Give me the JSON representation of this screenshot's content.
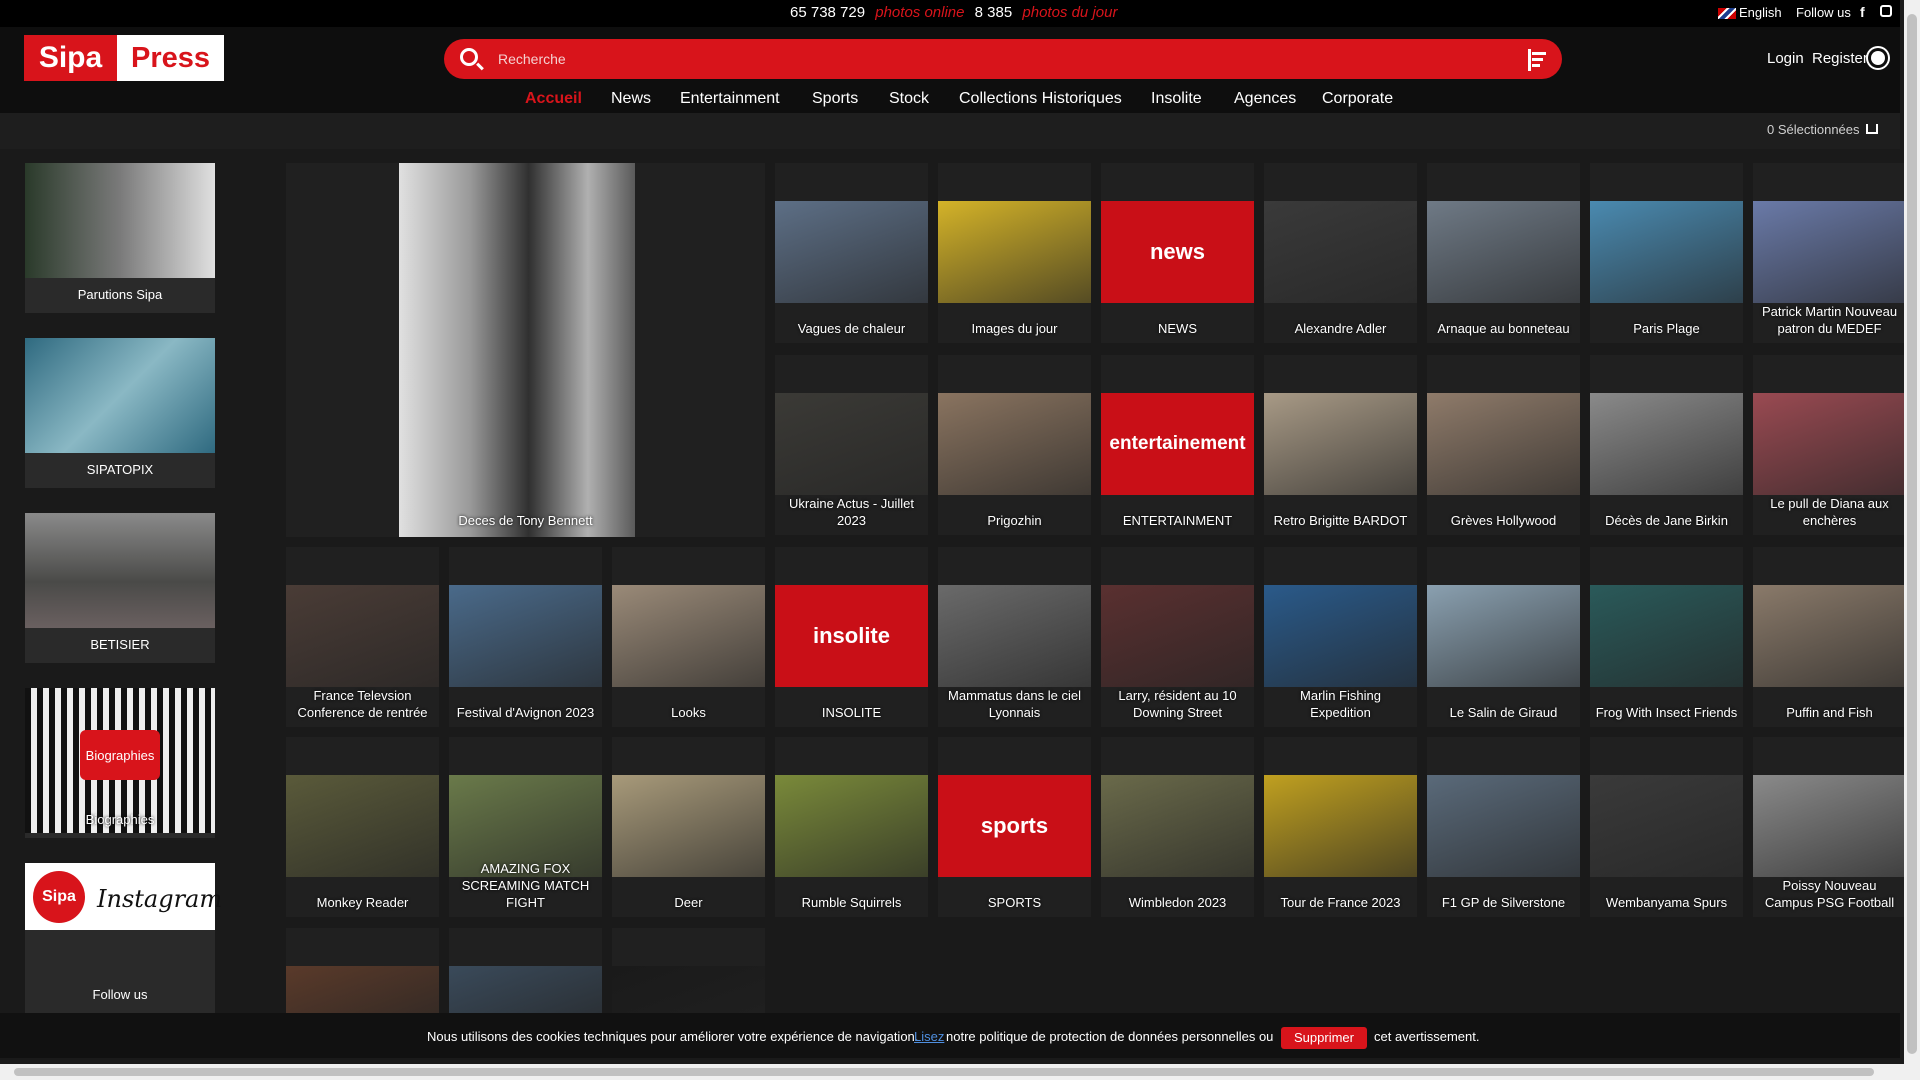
{
  "topbar": {
    "photos_online_count": "65 738 729",
    "photos_online_label": "photos online",
    "photos_day_count": "8 385",
    "photos_day_label": "photos du jour",
    "language": "English",
    "follow": "Follow us",
    "fb": "f"
  },
  "header": {
    "logo_sipa": "Sipa",
    "logo_press": "Press",
    "search_placeholder": "Recherche",
    "login": "Login",
    "register": "Register"
  },
  "nav": [
    "Accueil",
    "News",
    "Entertainment",
    "Sports",
    "Stock",
    "Collections Historiques",
    "Insolite",
    "Agences",
    "Corporate"
  ],
  "selection": "0 Sélectionnées",
  "sidebar": [
    {
      "label": "Parutions Sipa",
      "color": "#6d6d6d"
    },
    {
      "label": "SIPATOPIX",
      "color": "#3f7c8e"
    },
    {
      "label": "BETISIER",
      "color": "#5b5f61"
    },
    {
      "label": "Biographies",
      "badge": "Biographies",
      "color": "#cfcfcf"
    },
    {
      "label": "Follow us",
      "badge": "Instagram",
      "color": "#ffffff"
    }
  ],
  "feature": {
    "label": "Deces de Tony Bennett"
  },
  "cards": [
    {
      "label": "Vagues de chaleur",
      "color": "#5d6f86"
    },
    {
      "label": "Images du jour",
      "color": "#d4b328"
    },
    {
      "label": "NEWS",
      "red": "news"
    },
    {
      "label": "Alexandre Adler",
      "color": "#3a3a3a"
    },
    {
      "label": "Arnaque au bonneteau",
      "color": "#6f7a86"
    },
    {
      "label": "Paris Plage",
      "color": "#4a8ab0"
    },
    {
      "label": "Patrick Martin Nouveau patron du MEDEF",
      "color": "#6a7aa8"
    },
    {
      "label": "Ukraine Actus - Juillet 2023",
      "color": "#3b3a36"
    },
    {
      "label": "Prigozhin",
      "color": "#8a7460"
    },
    {
      "label": "ENTERTAINMENT",
      "red": "entertainement"
    },
    {
      "label": "Retro Brigitte BARDOT",
      "color": "#a89a86"
    },
    {
      "label": "Grèves Hollywood",
      "color": "#8f7b6a"
    },
    {
      "label": "Décès de Jane Birkin",
      "color": "#8a8a8a"
    },
    {
      "label": "Le pull de Diana aux enchères",
      "color": "#9a4a52"
    },
    {
      "label": "France Televsion Conference de rentrée",
      "color": "#4a3c36"
    },
    {
      "label": "Festival d'Avignon 2023",
      "color": "#4a6a8a"
    },
    {
      "label": "Looks",
      "color": "#9a8a78"
    },
    {
      "label": "INSOLITE",
      "red": "insolite"
    },
    {
      "label": "Mammatus dans le ciel Lyonnais",
      "color": "#6a6a6a"
    },
    {
      "label": "Larry, résident au 10 Downing Street",
      "color": "#5a3030"
    },
    {
      "label": "Marlin Fishing Expedition",
      "color": "#2a5a8a"
    },
    {
      "label": "Le Salin de Giraud",
      "color": "#8aa0b0"
    },
    {
      "label": "Frog With Insect Friends",
      "color": "#2a5a5a"
    },
    {
      "label": "Puffin and Fish",
      "color": "#8a7a6a"
    },
    {
      "label": "Monkey Reader",
      "color": "#5a5a3a"
    },
    {
      "label": "AMAZING FOX SCREAMING MATCH FIGHT",
      "color": "#6a7a4a"
    },
    {
      "label": "Deer",
      "color": "#a89a7a"
    },
    {
      "label": "Rumble Squirrels",
      "color": "#7a8a3a"
    },
    {
      "label": "SPORTS",
      "red": "sports"
    },
    {
      "label": "Wimbledon 2023",
      "color": "#6a6a4a"
    },
    {
      "label": "Tour de France 2023",
      "color": "#c0a020"
    },
    {
      "label": "F1 GP de Silverstone",
      "color": "#5a6a7a"
    },
    {
      "label": "Wembanyama Spurs",
      "color": "#3a3a3a"
    },
    {
      "label": "Poissy Nouveau Campus PSG Football",
      "color": "#8a8a8a"
    },
    {
      "label": "",
      "color": "#5a3a2a"
    },
    {
      "label": "",
      "color": "#3a4a5a"
    },
    {
      "label": "",
      "color": "#1a1a1a"
    }
  ],
  "cookie": {
    "msg": "Nous utilisons des cookies techniques pour améliorer votre expérience de navigation.",
    "link": "Lisez",
    "msg2": "notre politique de protection de données personnelles ou",
    "button": "Supprimer",
    "msg3": "cet avertissement."
  }
}
